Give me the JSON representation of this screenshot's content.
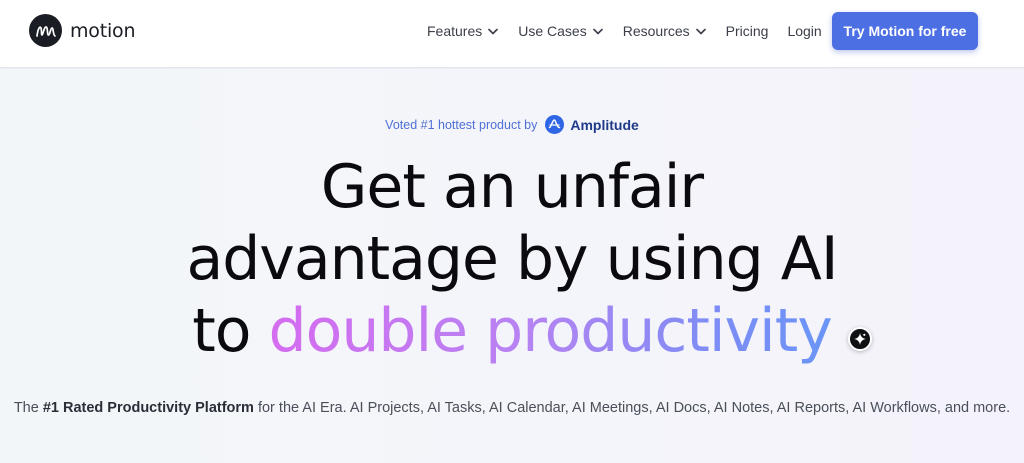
{
  "header": {
    "logo_text": "motion",
    "nav": [
      {
        "label": "Features",
        "has_dropdown": true,
        "icon": "chevron-down-icon"
      },
      {
        "label": "Use Cases",
        "has_dropdown": true,
        "icon": "chevron-down-icon"
      },
      {
        "label": "Resources",
        "has_dropdown": true,
        "icon": "chevron-down-icon"
      },
      {
        "label": "Pricing",
        "has_dropdown": false
      },
      {
        "label": "Login",
        "has_dropdown": false
      }
    ],
    "cta_label": "Try Motion for free"
  },
  "hero": {
    "badge": {
      "text": "Voted #1 hottest product by",
      "brand_icon": "amplitude-logo-icon",
      "brand": "Amplitude"
    },
    "headline": {
      "line1": "Get an unfair",
      "line2": "advantage by using AI",
      "line3_prefix": "to ",
      "line3_highlight": "double productivity"
    },
    "sparkle_icon": "sparkle-chat-icon",
    "subtext": {
      "prefix": "The ",
      "bold": "#1 Rated Productivity Platform",
      "suffix": " for the AI Era. AI Projects, AI Tasks, AI Calendar, AI Meetings, AI Docs, AI Notes, AI Reports, AI Workflows, and more."
    }
  },
  "colors": {
    "accent": "#4c6fe4",
    "badge_text": "#4f6fd6",
    "gradient_start": "#d56cf0",
    "gradient_end": "#6a95f7",
    "headline": "#0b0b0f"
  }
}
